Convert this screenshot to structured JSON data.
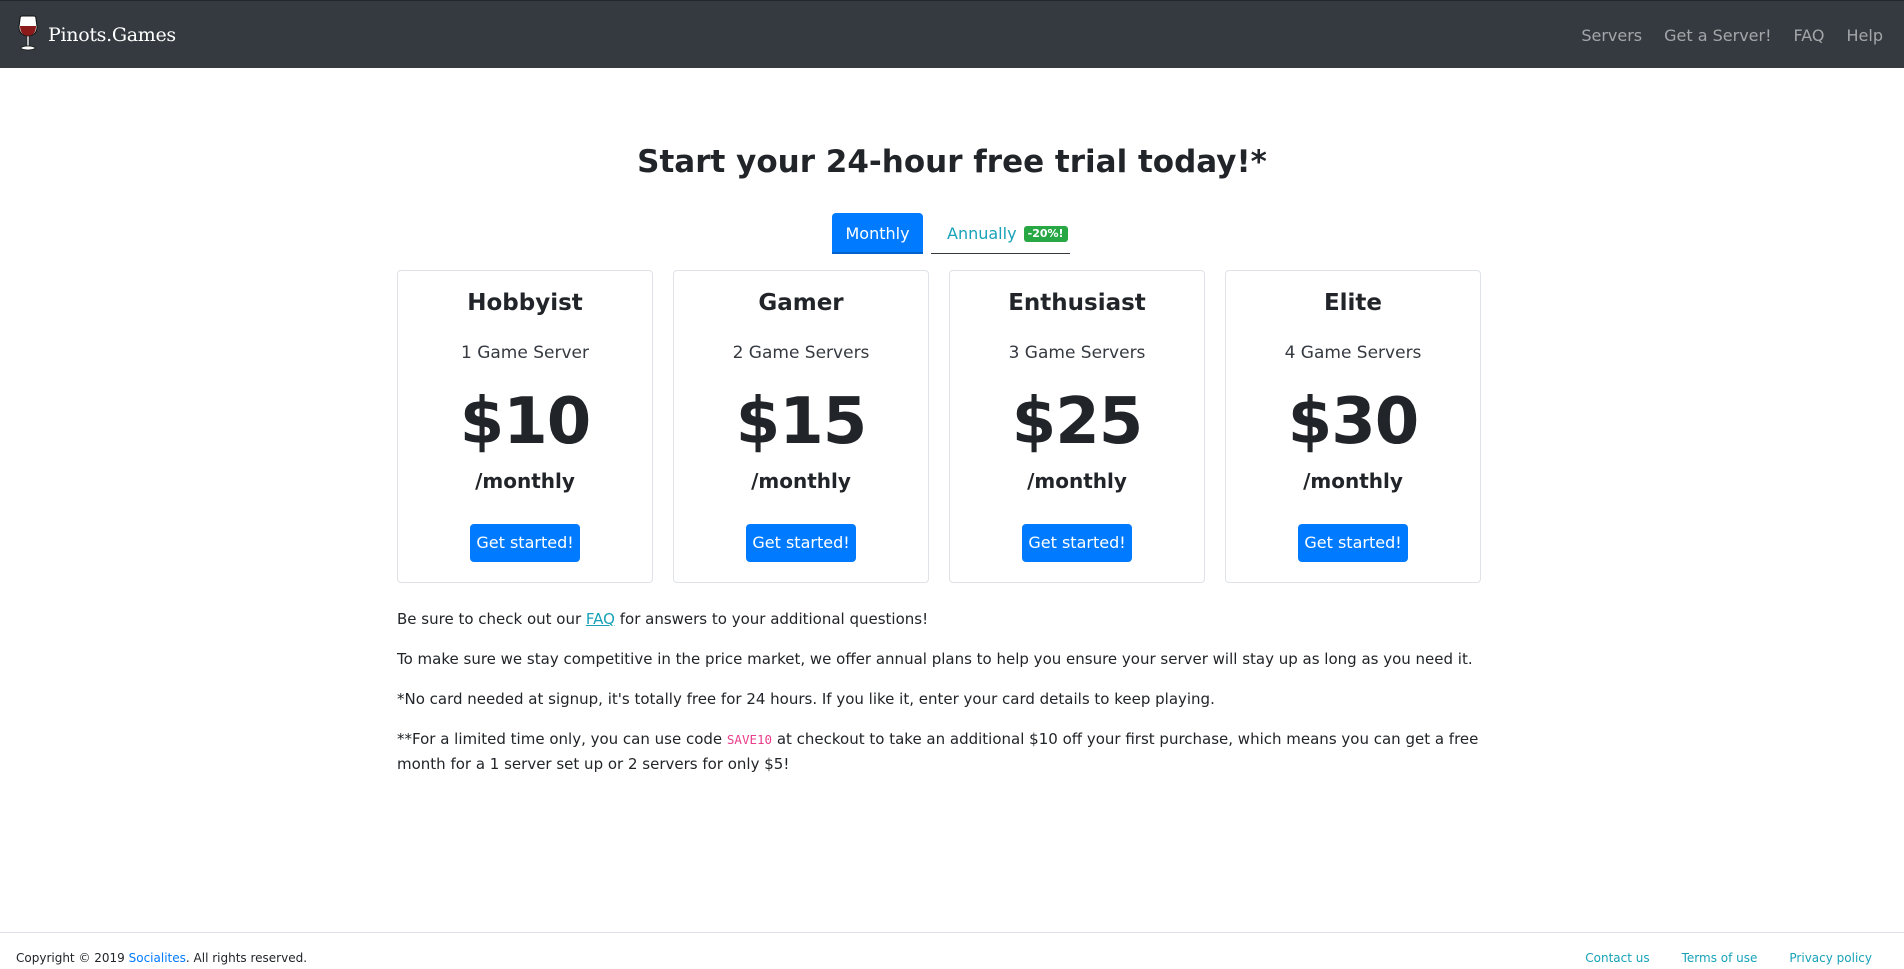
{
  "navbar": {
    "brand": "Pinots.Games",
    "links": [
      "Servers",
      "Get a Server!",
      "FAQ",
      "Help"
    ]
  },
  "main": {
    "title": "Start your 24-hour free trial today!*",
    "toggle": {
      "monthly": "Monthly",
      "annual": "Annually",
      "discount": "-20%!"
    },
    "plans": [
      {
        "name": "Hobbyist",
        "servers": "1 Game Server",
        "price": "$10",
        "period": "/monthly",
        "cta": "Get started!"
      },
      {
        "name": "Gamer",
        "servers": "2 Game Servers",
        "price": "$15",
        "period": "/monthly",
        "cta": "Get started!"
      },
      {
        "name": "Enthusiast",
        "servers": "3 Game Servers",
        "price": "$25",
        "period": "/monthly",
        "cta": "Get started!"
      },
      {
        "name": "Elite",
        "servers": "4 Game Servers",
        "price": "$30",
        "period": "/monthly",
        "cta": "Get started!"
      }
    ],
    "notes": {
      "faq_prefix": "Be sure to check out our ",
      "faq_link": "FAQ",
      "faq_suffix": " for answers to your additional questions!",
      "annual_note": "To make sure we stay competitive in the price market, we offer annual plans to help you ensure your server will stay up as long as you need it.",
      "card_note": "*No card needed at signup, it's totally free for 24 hours. If you like it, enter your card details to keep playing.",
      "promo_prefix": "**For a limited time only, you can use code ",
      "promo_code": "SAVE10",
      "promo_suffix": " at checkout to take an additional $10 off your first purchase, which means you can get a free month for a 1 server set up or 2 servers for only $5!"
    }
  },
  "footer": {
    "copyright_prefix": "Copyright © 2019 ",
    "company": "Socialites",
    "copyright_suffix": ". All rights reserved.",
    "links": [
      "Contact us",
      "Terms of use",
      "Privacy policy"
    ]
  },
  "colors": {
    "navbar": "#343a40",
    "primary": "#007bff",
    "info": "#17a2b8",
    "success": "#28a745",
    "code": "#e83e8c",
    "wine": "#8b1a1a"
  },
  "icons": {
    "brand": "wine-glass-icon"
  }
}
